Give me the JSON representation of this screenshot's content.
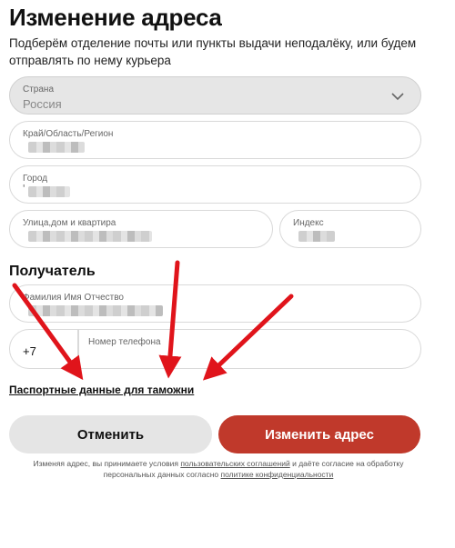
{
  "page": {
    "title": "Изменение адреса",
    "subtitle": "Подберём отделение почты или пункты выдачи неподалёку, или будем отправлять по нему курьера"
  },
  "address": {
    "country": {
      "label": "Страна",
      "value": "Россия"
    },
    "region": {
      "label": "Край/Область/Регион"
    },
    "city": {
      "label": "Город",
      "value_prefix": "'"
    },
    "street": {
      "label": "Улица,дом и квартира"
    },
    "index": {
      "label": "Индекс"
    }
  },
  "recipient": {
    "section_title": "Получатель",
    "full_name": {
      "label": "Фамилия Имя Отчество"
    },
    "phone": {
      "prefix": "+7",
      "label": "Номер телефона"
    }
  },
  "passport_link": "Паспортные данные для таможни",
  "buttons": {
    "cancel": "Отменить",
    "submit": "Изменить адрес"
  },
  "legal": {
    "part1": "Изменяя адрес, вы принимаете условия ",
    "link1": "пользовательских соглашений",
    "part2": " и даёте согласие на обработку персональных данных согласно ",
    "link2": "политике конфиденциальности"
  },
  "colors": {
    "accent": "#c0392b",
    "annotation_arrow": "#e0141b",
    "disabled_field": "#e6e6e6"
  },
  "icons": {
    "country_dropdown": "chevron-down-icon"
  }
}
